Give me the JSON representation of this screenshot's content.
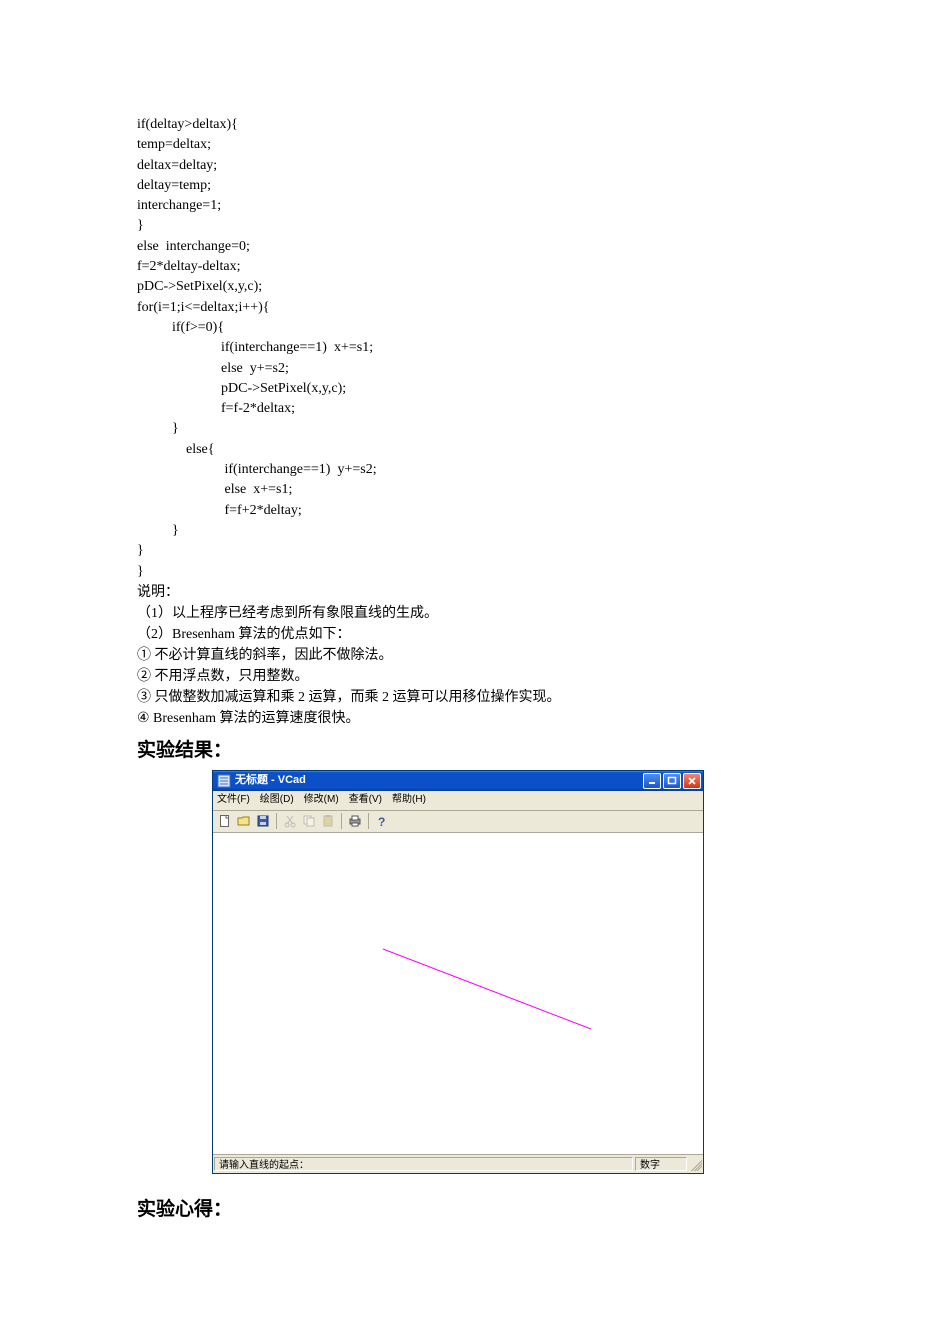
{
  "code_lines": [
    "if(deltay>deltax){",
    "temp=deltax;",
    "deltax=deltay;",
    "deltay=temp;",
    "interchange=1;",
    "}",
    "else  interchange=0;",
    "f=2*deltay-deltax;",
    "pDC->SetPixel(x,y,c);",
    "for(i=1;i<=deltax;i++){",
    "          if(f>=0){",
    "                        if(interchange==1)  x+=s1;",
    "                        else  y+=s2;",
    "                        pDC->SetPixel(x,y,c);",
    "                        f=f-2*deltax;",
    "          }",
    "              else{",
    "                         if(interchange==1)  y+=s2;",
    "                         else  x+=s1;",
    "                         f=f+2*deltay;",
    "          }",
    "}",
    "}"
  ],
  "desc": {
    "l0": "说明：",
    "l1": "（1）以上程序已经考虑到所有象限直线的生成。",
    "l2": "（2）Bresenham 算法的优点如下：",
    "l3": "① 不必计算直线的斜率，因此不做除法。",
    "l4": "② 不用浮点数，只用整数。",
    "l5": "③ 只做整数加减运算和乘 2 运算，而乘 2 运算可以用移位操作实现。",
    "l6": "④ Bresenham 算法的运算速度很快。"
  },
  "heading1": "实验结果：",
  "heading2": "实验心得：",
  "app": {
    "title": "无标题 - VCad",
    "menu": {
      "file": "文件(F)",
      "draw": "绘图(D)",
      "edit": "修改(M)",
      "view": "查看(V)",
      "help": "帮助(H)"
    },
    "status_left": "请输入直线的起点：",
    "status_right": "数字"
  }
}
